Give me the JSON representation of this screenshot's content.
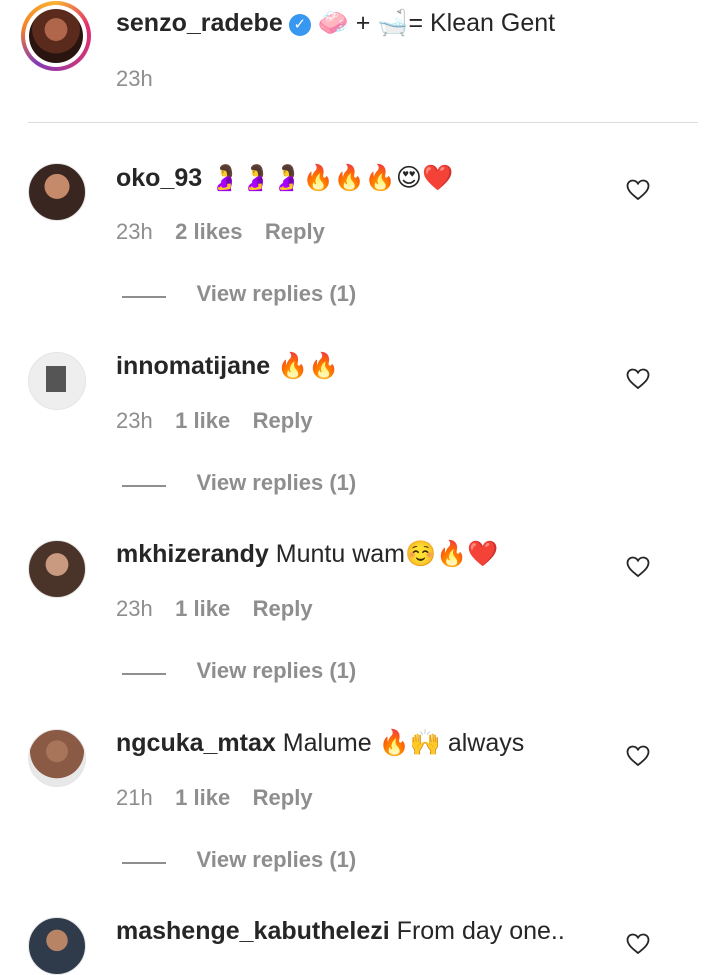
{
  "caption": {
    "username": "senzo_radebe",
    "text": "🧼 + 🛁= Klean Gent",
    "time": "23h"
  },
  "comments": [
    {
      "username": "oko_93",
      "text": "🤰🤰🤰🔥🔥🔥😍❤️",
      "time": "23h",
      "likes": "2 likes",
      "reply_label": "Reply",
      "view_replies": "View replies (1)",
      "avatar_color": "#3a2620"
    },
    {
      "username": "innomatijane",
      "text": "🔥🔥",
      "time": "23h",
      "likes": "1 like",
      "reply_label": "Reply",
      "view_replies": "View replies (1)",
      "avatar_color": "#d9d9d9"
    },
    {
      "username": "mkhizerandy",
      "text": "Muntu wam☺️🔥❤️",
      "time": "23h",
      "likes": "1 like",
      "reply_label": "Reply",
      "view_replies": "View replies (1)",
      "avatar_color": "#4a3429"
    },
    {
      "username": "ngcuka_mtax",
      "text": "Malume 🔥🙌 always",
      "time": "21h",
      "likes": "1 like",
      "reply_label": "Reply",
      "view_replies": "View replies (1)",
      "avatar_color": "#8a5a44"
    },
    {
      "username": "mashenge_kabuthelezi",
      "text": "From day one..",
      "time": "",
      "likes": "",
      "reply_label": "",
      "view_replies": "",
      "avatar_color": "#2f3b4a"
    }
  ],
  "icons": {
    "heart": "heart-outline-icon",
    "verified": "verified-badge-icon"
  }
}
